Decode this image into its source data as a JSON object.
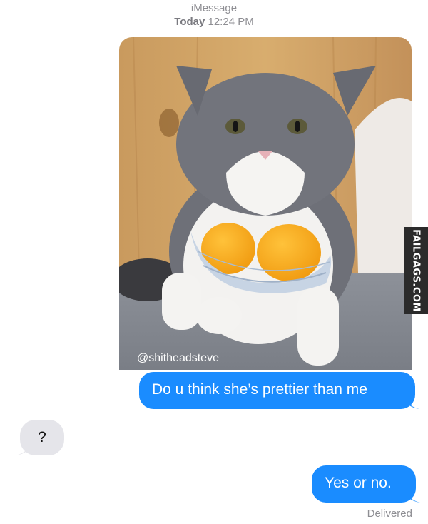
{
  "header": {
    "service": "iMessage",
    "day": "Today",
    "time": "12:24 PM"
  },
  "photo": {
    "caption": "@shitheadsteve",
    "subject_icon": "cat-photo"
  },
  "watermark": {
    "text": "FAILGAGS.COM"
  },
  "messages": [
    {
      "direction": "outgoing",
      "text": "Do u think she’s prettier than me"
    },
    {
      "direction": "incoming",
      "text": "?"
    },
    {
      "direction": "outgoing",
      "text": "Yes or no."
    }
  ],
  "status": {
    "delivered": "Delivered"
  },
  "colors": {
    "outgoing_bubble": "#1a8cff",
    "incoming_bubble": "#e5e5ea",
    "meta_text": "#8e8e93"
  }
}
